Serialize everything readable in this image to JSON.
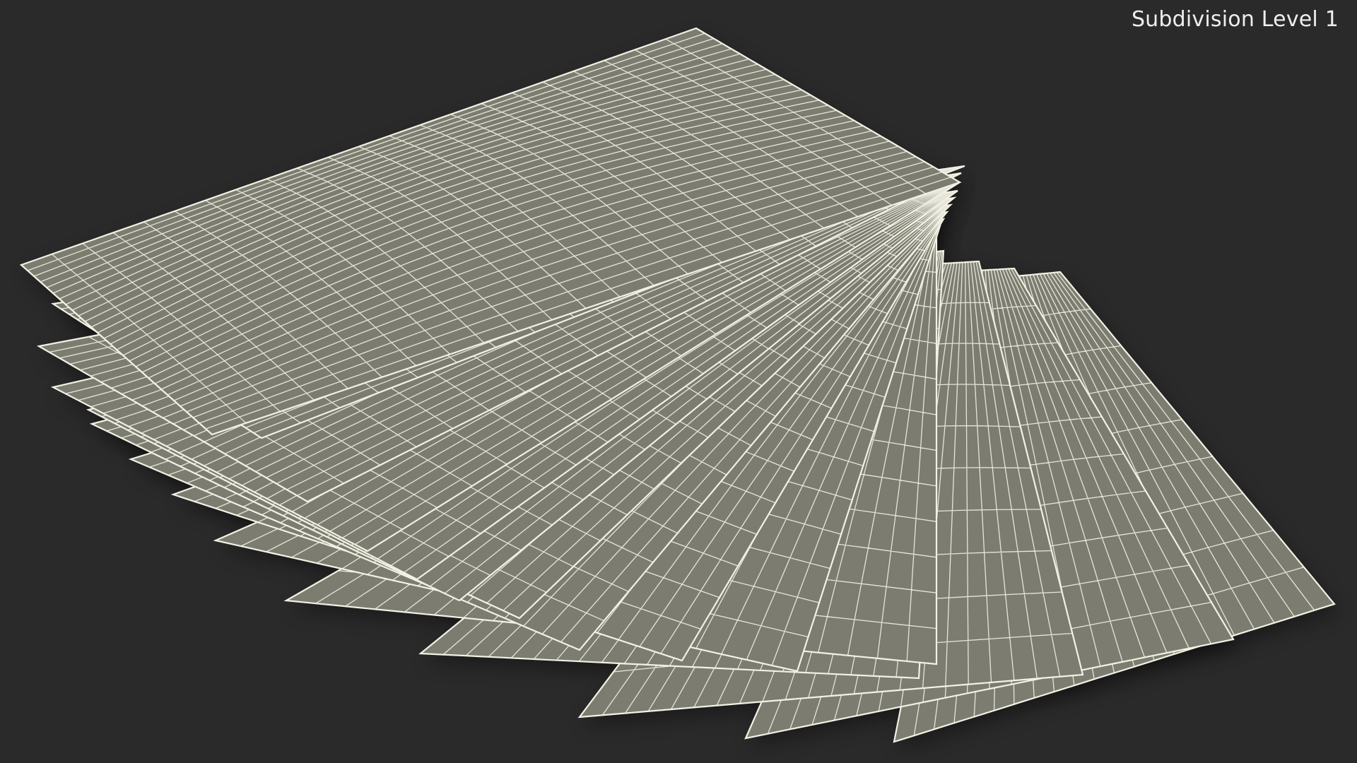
{
  "viewport": {
    "label": "Subdivision Level 1",
    "background_color": "#2a2a2a",
    "sheet_fill_color": "#7c7d70",
    "wire_color": "#f2f1e4"
  }
}
